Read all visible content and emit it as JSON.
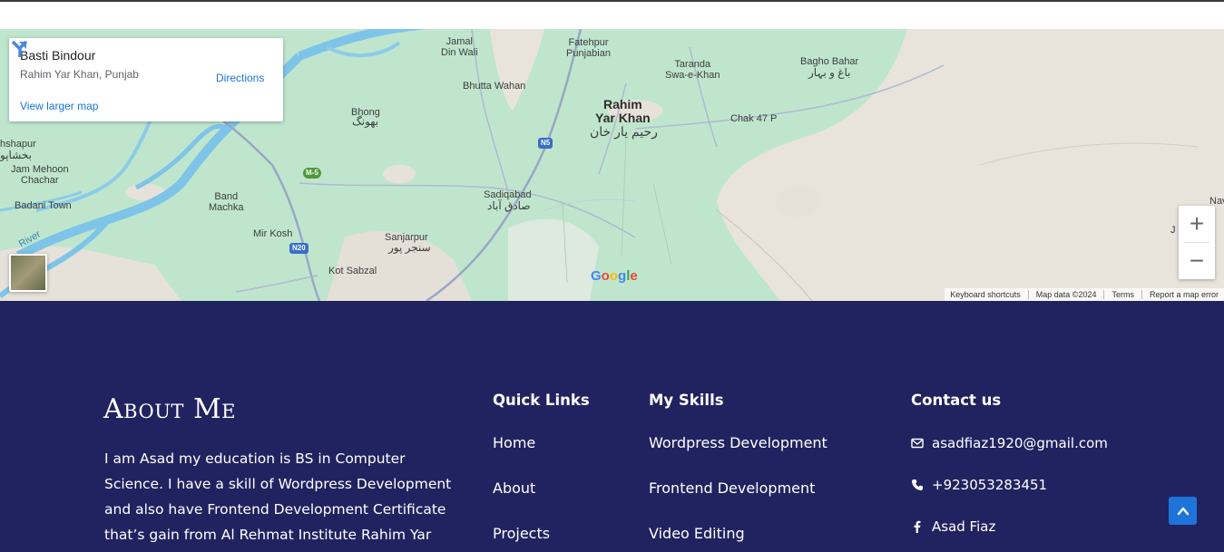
{
  "map": {
    "place_name": "Basti Bindour",
    "place_address": "Rahim Yar Khan, Punjab",
    "directions_label": "Directions",
    "larger_map_label": "View larger map",
    "zoom_in_label": "+",
    "zoom_out_label": "−",
    "google_logo": [
      "G",
      "o",
      "o",
      "g",
      "l",
      "e"
    ],
    "attribution": {
      "keyboard": "Keyboard shortcuts",
      "map_data": "Map data ©2024",
      "terms": "Terms",
      "report": "Report a map error"
    },
    "labels": {
      "jamal_din_wali": "Jamal\nDin Wali",
      "fatehpur": "Fatehpur\nPunjabian",
      "taranda": "Taranda\nSwa-e-Khan",
      "bagho_bahar": "Bagho Bahar",
      "bagho_bahar_urdu": "باغ و بہار",
      "bhutta_wahan": "Bhutta Wahan",
      "rahim_yar_khan": "Rahim\nYar Khan",
      "rahim_yar_khan_urdu": "رحیم یار خان",
      "chak_47p": "Chak 47 P",
      "bhong": "Bhong",
      "bhong_urdu": "بھونگ",
      "shapur": "hshapur",
      "shapur_urdu": "بخشاپو",
      "jam_mehoon": "Jam Mehoon\nChachar",
      "badani_town": "Badani Town",
      "band_machka": "Band\nMachka",
      "sadiqabad": "Sadiqabad",
      "sadiqabad_urdu": "صادق آباد",
      "mir_kosh": "Mir Kosh",
      "sanjarpur": "Sanjarpur",
      "sanjarpur_urdu": "سنجر پور",
      "kot_sabzal": "Kot Sabzal",
      "river": "River",
      "nav_partial": "Nav",
      "j_partial": "J"
    },
    "shields": {
      "n5": "N5",
      "m5": "M-5",
      "n20": "N20"
    }
  },
  "footer": {
    "about": {
      "title": "About Me",
      "text": "I am Asad my education is BS in Computer Science. I have a skill of  Wordpress Development and also have Frontend Development Certificate that’s gain from Al Rehmat Institute Rahim Yar"
    },
    "quick_links": {
      "heading": "Quick Links",
      "items": [
        "Home",
        "About",
        "Projects"
      ]
    },
    "skills": {
      "heading": "My Skills",
      "items": [
        "Wordpress Development",
        "Frontend Development",
        "Video Editing"
      ]
    },
    "contact": {
      "heading": "Contact us",
      "email": "asadfiaz1920@gmail.com",
      "phone": "+923053283451",
      "facebook": "Asad Fiaz"
    }
  },
  "colors": {
    "footer_bg": "#212360",
    "link_blue": "#1a73e8",
    "back_to_top": "#1f74d9",
    "map_land": "#bfe6cd",
    "map_desert": "#e8e4dc",
    "map_water": "#7ec4e8"
  },
  "icons": {
    "directions": "directions-arrow-icon",
    "email": "envelope-icon",
    "phone": "phone-icon",
    "facebook": "facebook-icon",
    "back_to_top": "chevron-up-icon"
  }
}
